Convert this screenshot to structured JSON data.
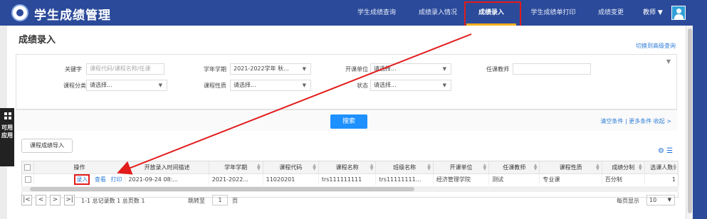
{
  "header": {
    "app_title": "学生成绩管理",
    "nav": [
      {
        "label": "学生成绩查询"
      },
      {
        "label": "成绩录入情况"
      },
      {
        "label": "成绩录入"
      },
      {
        "label": "学生成绩单打印"
      },
      {
        "label": "成绩变更"
      }
    ],
    "user_label": "教师 ▼",
    "icons": [
      "school-logo-icon",
      "user-avatar-icon"
    ]
  },
  "page": {
    "title": "成绩录入",
    "advanced_link": "切换到高级查询"
  },
  "filters": {
    "keyword_label": "关键字",
    "keyword_placeholder": "课程代码/课程名称/任课",
    "term_label": "学年学期",
    "term_value": "2021-2022学年 秋...",
    "unit_label": "开课单位",
    "unit_value": "请选择...",
    "teacher_label": "任课教师",
    "teacher_value": "",
    "category_label": "课程分类",
    "category_value": "请选择...",
    "nature_label": "课程性质",
    "nature_value": "请选择...",
    "status_label": "状态",
    "status_value": "请选择..."
  },
  "search": {
    "button": "搜索",
    "links": "清空条件 | 更多条件   收起 >"
  },
  "side_float": {
    "text": "可用应用"
  },
  "toolbar": {
    "import_button": "课程成绩导入"
  },
  "table": {
    "columns": [
      "操作",
      "开放录入时间描述",
      "学年学期",
      "课程代码",
      "课程名称",
      "班级名称",
      "开课单位",
      "任课教师",
      "课程性质",
      "成绩分制",
      "选课人数"
    ],
    "rows": [
      {
        "ops": [
          "录入",
          "查看",
          "打印"
        ],
        "cells": [
          "2021-09-24 08:...",
          "2021-2022...",
          "11020201",
          "trs111111111",
          "trs11111111...",
          "经济管理学院",
          "测试",
          "专业课",
          "百分制",
          "1"
        ]
      }
    ]
  },
  "pager": {
    "summary": "1-1 总记录数 1   总页数 1",
    "goto_label": "跳转至",
    "goto_value": "1",
    "page_unit": "页",
    "per_page_label": "每页显示",
    "per_page_value": "10"
  },
  "colors": {
    "header_bg": "#2b4a9a",
    "accent": "#1e90ff",
    "link": "#2f7ed8",
    "annotation": "#e21b1b"
  }
}
